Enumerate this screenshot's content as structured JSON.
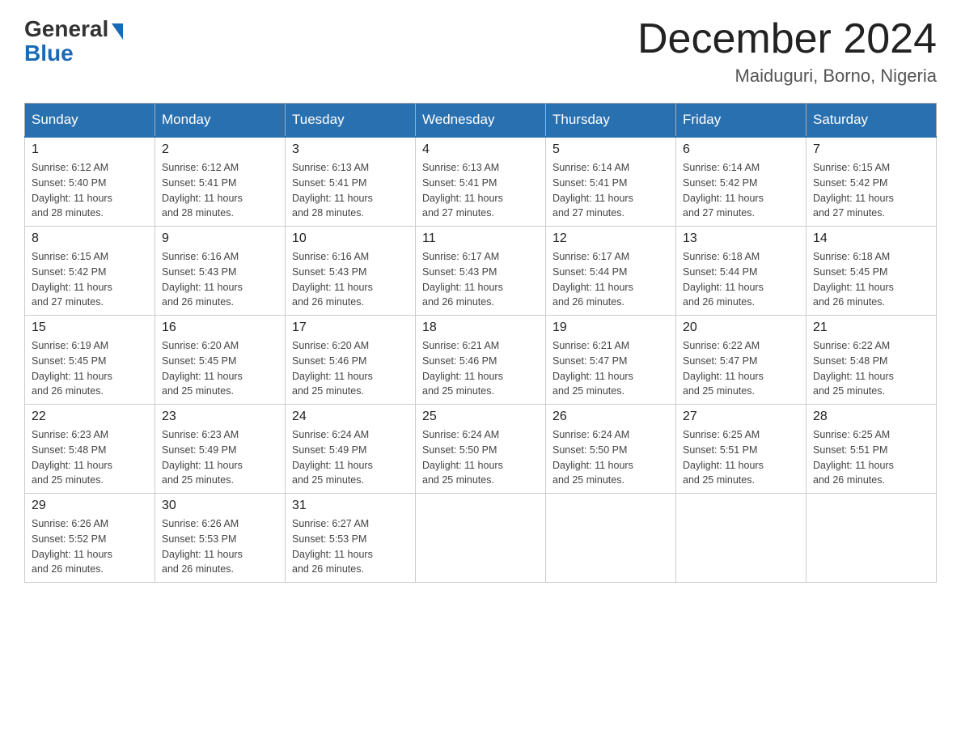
{
  "header": {
    "logo_general": "General",
    "logo_blue": "Blue",
    "month": "December 2024",
    "location": "Maiduguri, Borno, Nigeria"
  },
  "days_of_week": [
    "Sunday",
    "Monday",
    "Tuesday",
    "Wednesday",
    "Thursday",
    "Friday",
    "Saturday"
  ],
  "weeks": [
    [
      {
        "day": "1",
        "sunrise": "6:12 AM",
        "sunset": "5:40 PM",
        "daylight": "11 hours and 28 minutes."
      },
      {
        "day": "2",
        "sunrise": "6:12 AM",
        "sunset": "5:41 PM",
        "daylight": "11 hours and 28 minutes."
      },
      {
        "day": "3",
        "sunrise": "6:13 AM",
        "sunset": "5:41 PM",
        "daylight": "11 hours and 28 minutes."
      },
      {
        "day": "4",
        "sunrise": "6:13 AM",
        "sunset": "5:41 PM",
        "daylight": "11 hours and 27 minutes."
      },
      {
        "day": "5",
        "sunrise": "6:14 AM",
        "sunset": "5:41 PM",
        "daylight": "11 hours and 27 minutes."
      },
      {
        "day": "6",
        "sunrise": "6:14 AM",
        "sunset": "5:42 PM",
        "daylight": "11 hours and 27 minutes."
      },
      {
        "day": "7",
        "sunrise": "6:15 AM",
        "sunset": "5:42 PM",
        "daylight": "11 hours and 27 minutes."
      }
    ],
    [
      {
        "day": "8",
        "sunrise": "6:15 AM",
        "sunset": "5:42 PM",
        "daylight": "11 hours and 27 minutes."
      },
      {
        "day": "9",
        "sunrise": "6:16 AM",
        "sunset": "5:43 PM",
        "daylight": "11 hours and 26 minutes."
      },
      {
        "day": "10",
        "sunrise": "6:16 AM",
        "sunset": "5:43 PM",
        "daylight": "11 hours and 26 minutes."
      },
      {
        "day": "11",
        "sunrise": "6:17 AM",
        "sunset": "5:43 PM",
        "daylight": "11 hours and 26 minutes."
      },
      {
        "day": "12",
        "sunrise": "6:17 AM",
        "sunset": "5:44 PM",
        "daylight": "11 hours and 26 minutes."
      },
      {
        "day": "13",
        "sunrise": "6:18 AM",
        "sunset": "5:44 PM",
        "daylight": "11 hours and 26 minutes."
      },
      {
        "day": "14",
        "sunrise": "6:18 AM",
        "sunset": "5:45 PM",
        "daylight": "11 hours and 26 minutes."
      }
    ],
    [
      {
        "day": "15",
        "sunrise": "6:19 AM",
        "sunset": "5:45 PM",
        "daylight": "11 hours and 26 minutes."
      },
      {
        "day": "16",
        "sunrise": "6:20 AM",
        "sunset": "5:45 PM",
        "daylight": "11 hours and 25 minutes."
      },
      {
        "day": "17",
        "sunrise": "6:20 AM",
        "sunset": "5:46 PM",
        "daylight": "11 hours and 25 minutes."
      },
      {
        "day": "18",
        "sunrise": "6:21 AM",
        "sunset": "5:46 PM",
        "daylight": "11 hours and 25 minutes."
      },
      {
        "day": "19",
        "sunrise": "6:21 AM",
        "sunset": "5:47 PM",
        "daylight": "11 hours and 25 minutes."
      },
      {
        "day": "20",
        "sunrise": "6:22 AM",
        "sunset": "5:47 PM",
        "daylight": "11 hours and 25 minutes."
      },
      {
        "day": "21",
        "sunrise": "6:22 AM",
        "sunset": "5:48 PM",
        "daylight": "11 hours and 25 minutes."
      }
    ],
    [
      {
        "day": "22",
        "sunrise": "6:23 AM",
        "sunset": "5:48 PM",
        "daylight": "11 hours and 25 minutes."
      },
      {
        "day": "23",
        "sunrise": "6:23 AM",
        "sunset": "5:49 PM",
        "daylight": "11 hours and 25 minutes."
      },
      {
        "day": "24",
        "sunrise": "6:24 AM",
        "sunset": "5:49 PM",
        "daylight": "11 hours and 25 minutes."
      },
      {
        "day": "25",
        "sunrise": "6:24 AM",
        "sunset": "5:50 PM",
        "daylight": "11 hours and 25 minutes."
      },
      {
        "day": "26",
        "sunrise": "6:24 AM",
        "sunset": "5:50 PM",
        "daylight": "11 hours and 25 minutes."
      },
      {
        "day": "27",
        "sunrise": "6:25 AM",
        "sunset": "5:51 PM",
        "daylight": "11 hours and 25 minutes."
      },
      {
        "day": "28",
        "sunrise": "6:25 AM",
        "sunset": "5:51 PM",
        "daylight": "11 hours and 26 minutes."
      }
    ],
    [
      {
        "day": "29",
        "sunrise": "6:26 AM",
        "sunset": "5:52 PM",
        "daylight": "11 hours and 26 minutes."
      },
      {
        "day": "30",
        "sunrise": "6:26 AM",
        "sunset": "5:53 PM",
        "daylight": "11 hours and 26 minutes."
      },
      {
        "day": "31",
        "sunrise": "6:27 AM",
        "sunset": "5:53 PM",
        "daylight": "11 hours and 26 minutes."
      },
      null,
      null,
      null,
      null
    ]
  ],
  "labels": {
    "sunrise": "Sunrise:",
    "sunset": "Sunset:",
    "daylight": "Daylight:"
  }
}
